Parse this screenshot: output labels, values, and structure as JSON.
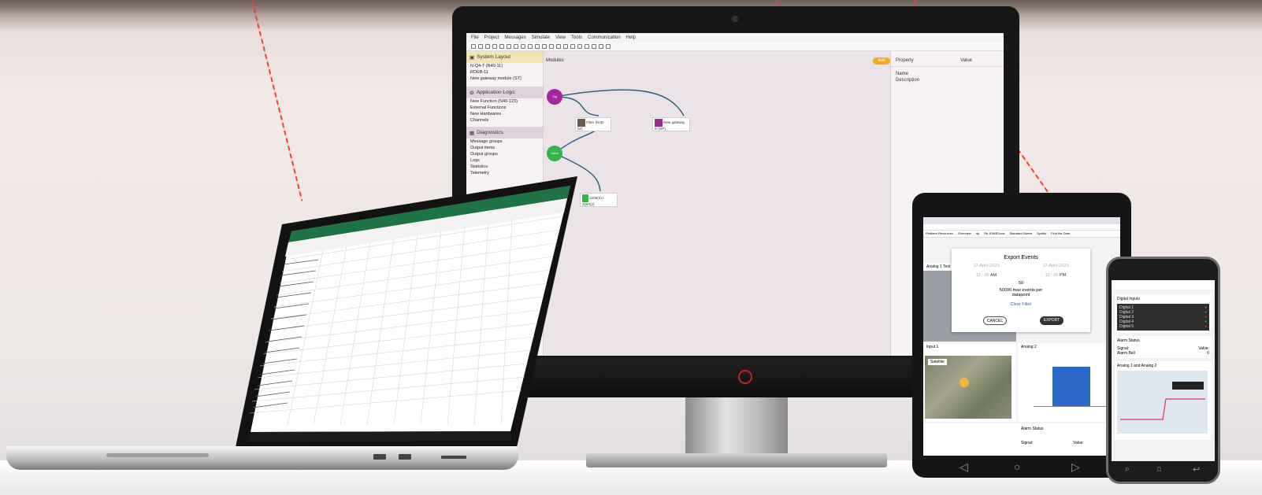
{
  "monitor": {
    "menu": [
      "File",
      "Project",
      "Messages",
      "Simulate",
      "View",
      "Tools",
      "Communication",
      "Help"
    ],
    "left_sections": [
      {
        "title": "System Layout",
        "items": [
          "N-Q4-T (N40-11)",
          "RDEB-11",
          "New gateway module (ST)"
        ]
      },
      {
        "title": "Application Logic",
        "items": [
          "New Function (N40-123)",
          "External Functions",
          "New Hardwares",
          "Channels"
        ]
      },
      {
        "title": "Diagnostics",
        "items": [
          "Message groups",
          "Output items",
          "Output groups",
          "Logs",
          "Statistics",
          "Telemetry"
        ]
      }
    ],
    "canvas_title": "Modules",
    "add_label": "Add",
    "node_labels": [
      "Sig",
      "Value"
    ],
    "module_labels": [
      "New gateway in (SP)",
      "Filter (N4D-02)",
      "2160(2) / 2160(2)"
    ],
    "prop_header": [
      "Property",
      "Value"
    ],
    "prop_rows": [
      "Name",
      "Description"
    ]
  },
  "laptop": {
    "app": "Excel spreadsheet"
  },
  "tablet": {
    "bookmarks": [
      "Platform Resources",
      "Overview",
      "dp",
      "Rb-IOWEDocs",
      "Standard Sweet",
      "Spotify",
      "Find the Date"
    ],
    "dialog_title": "Export Events",
    "date1": "17-April-2023",
    "date2": "17-April-2023",
    "time1": [
      "12",
      "00",
      "AM"
    ],
    "time2": [
      "12",
      "00",
      "PM"
    ],
    "count": "50",
    "note": "50000 max events per datapoint",
    "clear": "Clear Filter",
    "cancel": "CANCEL",
    "export": "EXPORT",
    "panels": [
      "Analog 1 Test",
      "Input 1",
      "Analog 2",
      "Alarm Status",
      "Satellite"
    ],
    "table_header": [
      "Signal:",
      "Value:"
    ]
  },
  "phone": {
    "panels": [
      "Digital Inputs",
      "Alarm Status",
      "Analog 1 and Analog 2"
    ],
    "inputs": [
      "Digital 1",
      "Digital 2",
      "Digital 3",
      "Digital 4",
      "Digital 5"
    ],
    "status_header": [
      "Signal:",
      "Value:"
    ],
    "status_row": [
      "Alarm Bell",
      "0"
    ]
  },
  "colors": {
    "accent": "#f6a81c",
    "magenta": "#a5259b",
    "green": "#36b34a",
    "laser": "#e8452d",
    "bar": "#2866c8"
  }
}
